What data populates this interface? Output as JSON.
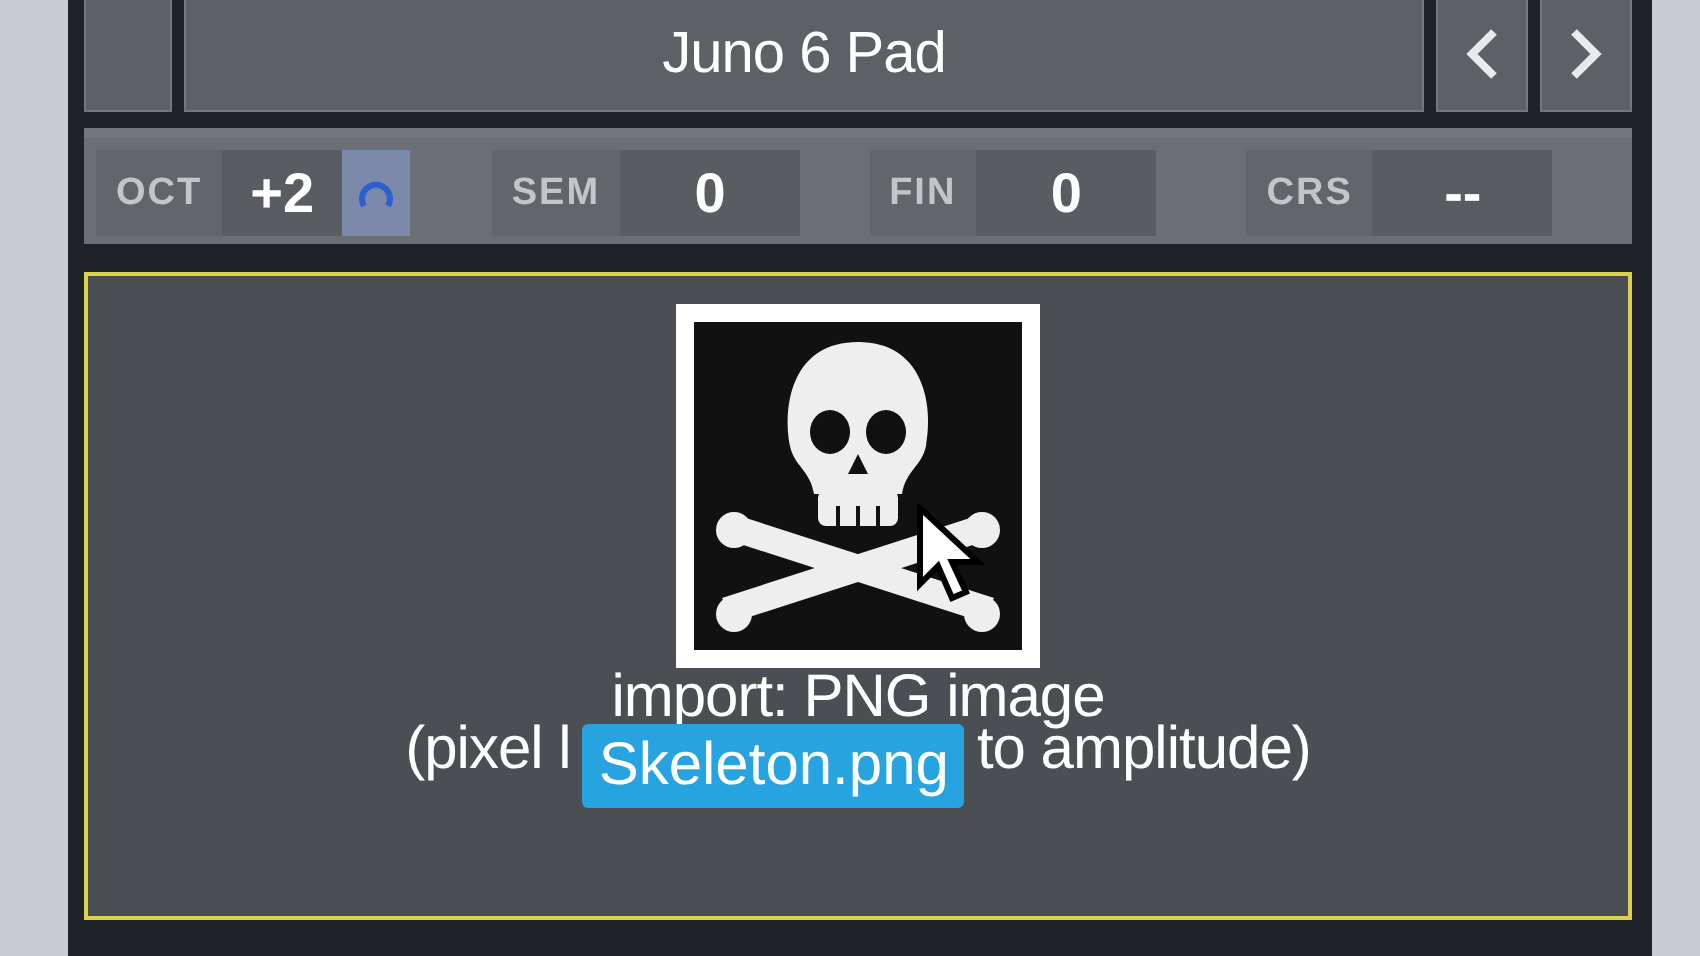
{
  "preset": {
    "name": "Juno 6 Pad"
  },
  "pitch": [
    {
      "label": "OCT",
      "value": "+2"
    },
    {
      "label": "SEM",
      "value": "0"
    },
    {
      "label": "FIN",
      "value": "0"
    },
    {
      "label": "CRS",
      "value": "--"
    }
  ],
  "drop_zone": {
    "line_1": "import: PNG image",
    "line_2_start": "(pixel l",
    "line_2_end": "to amplitude)",
    "drag_file": "Skeleton.png"
  }
}
